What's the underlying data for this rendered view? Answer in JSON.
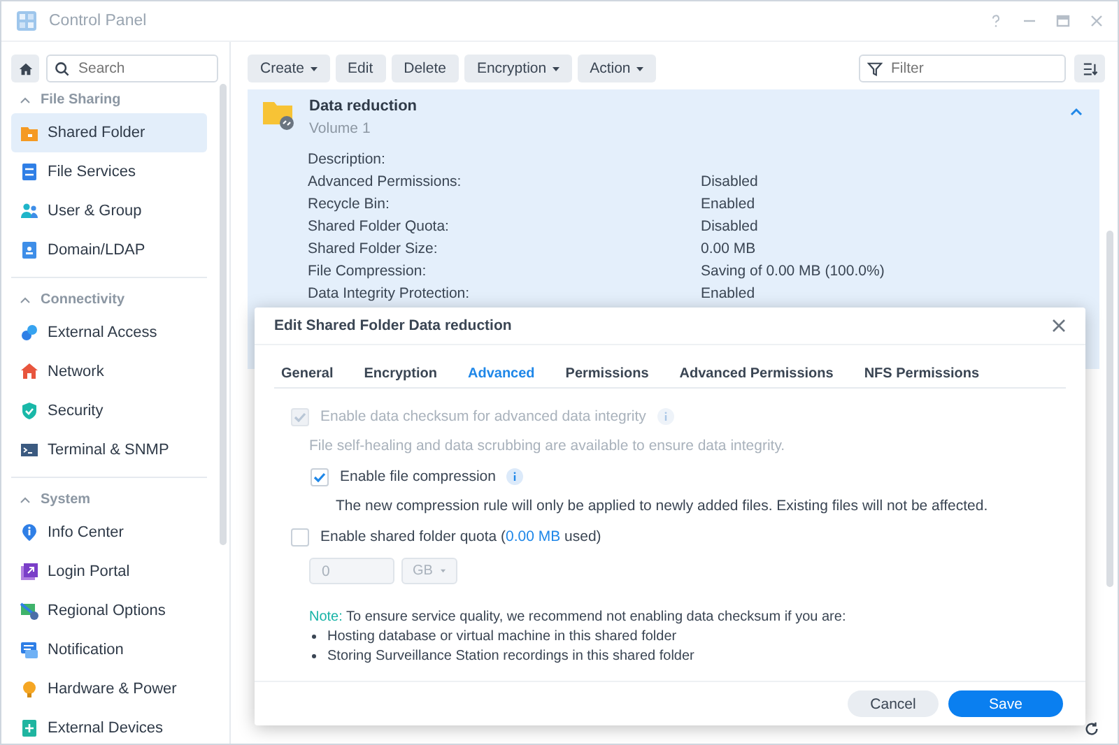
{
  "window": {
    "title": "Control Panel"
  },
  "sidebar": {
    "search": {
      "placeholder": "Search"
    },
    "groups": [
      {
        "label": "File Sharing",
        "expanded": true,
        "items": [
          {
            "label": "Shared Folder",
            "selected": true
          },
          {
            "label": "File Services",
            "selected": false
          },
          {
            "label": "User & Group",
            "selected": false
          },
          {
            "label": "Domain/LDAP",
            "selected": false
          }
        ]
      },
      {
        "label": "Connectivity",
        "expanded": true,
        "items": [
          {
            "label": "External Access",
            "selected": false
          },
          {
            "label": "Network",
            "selected": false
          },
          {
            "label": "Security",
            "selected": false
          },
          {
            "label": "Terminal & SNMP",
            "selected": false
          }
        ]
      },
      {
        "label": "System",
        "expanded": true,
        "items": [
          {
            "label": "Info Center",
            "selected": false
          },
          {
            "label": "Login Portal",
            "selected": false
          },
          {
            "label": "Regional Options",
            "selected": false
          },
          {
            "label": "Notification",
            "selected": false
          },
          {
            "label": "Hardware & Power",
            "selected": false
          },
          {
            "label": "External Devices",
            "selected": false
          }
        ]
      }
    ]
  },
  "toolbar": {
    "buttons": [
      {
        "label": "Create",
        "menu": true
      },
      {
        "label": "Edit",
        "menu": false
      },
      {
        "label": "Delete",
        "menu": false
      },
      {
        "label": "Encryption",
        "menu": true
      },
      {
        "label": "Action",
        "menu": true
      }
    ],
    "filter": {
      "placeholder": "Filter"
    }
  },
  "folder": {
    "name": "Data reduction",
    "volume": "Volume 1",
    "expanded": true,
    "properties": [
      {
        "label": "Description:"
      },
      {
        "label": "Advanced Permissions:",
        "value": "Disabled"
      },
      {
        "label": "Recycle Bin:",
        "value": "Enabled"
      },
      {
        "label": "Shared Folder Quota:",
        "value": "Disabled"
      },
      {
        "label": "Shared Folder Size:",
        "value": "0.00 MB"
      },
      {
        "label": "File Compression:",
        "value": "Saving of 0.00 MB (100.0%)"
      },
      {
        "label": "Data Integrity Protection:",
        "value": "Enabled"
      }
    ]
  },
  "dialog": {
    "title": "Edit Shared Folder Data reduction",
    "tabs": [
      {
        "label": "General",
        "selected": false
      },
      {
        "label": "Encryption",
        "selected": false
      },
      {
        "label": "Advanced",
        "selected": true
      },
      {
        "label": "Permissions",
        "selected": false
      },
      {
        "label": "Advanced Permissions",
        "selected": false
      },
      {
        "label": "NFS Permissions",
        "selected": false
      }
    ],
    "checksum": {
      "label": "Enable data checksum for advanced data integrity",
      "checked": true,
      "disabled": true,
      "hint": "File self-healing and data scrubbing are available to ensure data integrity."
    },
    "compression": {
      "label": "Enable file compression",
      "checked": true,
      "disabled": false,
      "hint": "The new compression rule will only be applied to newly added files. Existing files will not be affected."
    },
    "quota": {
      "label": "Enable shared folder quota (",
      "usage": "0.00 MB",
      "suffix": " used)",
      "checked": false,
      "disabled": false,
      "value": "0",
      "unit": "GB"
    },
    "note": {
      "label": "Note:",
      "text": "To ensure service quality, we recommend not enabling data checksum if you are:",
      "bullets": [
        "Hosting database or virtual machine in this shared folder",
        "Storing Surveillance Station recordings in this shared folder"
      ]
    },
    "buttons": [
      {
        "label": "Cancel",
        "kind": "secondary"
      },
      {
        "label": "Save",
        "kind": "primary"
      }
    ]
  }
}
